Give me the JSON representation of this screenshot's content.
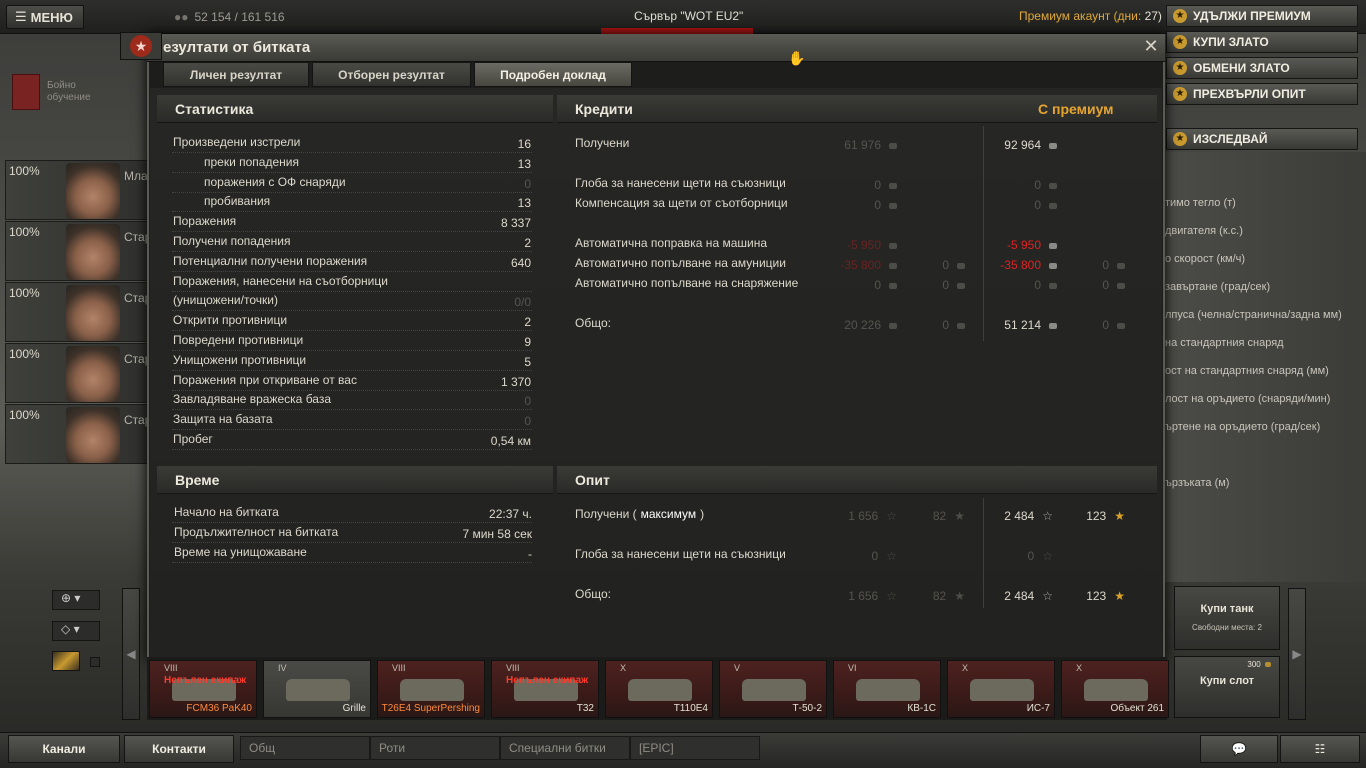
{
  "topbar": {
    "menu_label": "МЕНЮ",
    "player_stats": "52 154 / 161 516",
    "server": "Сървър \"WOT EU2\"",
    "premium_label": "Премиум акаунт (дни:",
    "premium_days": "27)"
  },
  "right_buttons": [
    {
      "label": "УДЪЛЖИ ПРЕМИУМ"
    },
    {
      "label": "КУПИ ЗЛАТО"
    },
    {
      "label": "ОБМЕНИ ЗЛАТО"
    },
    {
      "label": "ПРЕХВЪРЛИ ОПИТ"
    },
    {
      "label": "ИЗСЛЕДВАЙ"
    }
  ],
  "tech_params": [
    "тимо тегло (т)",
    "двигателя (к.с.)",
    "о скорост (км/ч)",
    "завъртане (град/сек)",
    "лпуса (челна/странична/задна мм)",
    "на стандартния снаряд",
    "ост на стандартния снаряд (мм)",
    "лост на оръдието (снаряди/мин)",
    "ъртене на оръдието (град/сек)",
    "ързъката (м)"
  ],
  "training": {
    "label_1": "Бойно",
    "label_2": "обучение"
  },
  "crew": [
    {
      "pct": "100%",
      "rank": "Мла"
    },
    {
      "pct": "100%",
      "rank": "Стар"
    },
    {
      "pct": "100%",
      "rank": "Стар"
    },
    {
      "pct": "100%",
      "rank": "Стар"
    },
    {
      "pct": "100%",
      "rank": "Стар"
    }
  ],
  "dialog": {
    "title": "езултати от битката",
    "tabs": [
      "Личен резултат",
      "Отборен резултат",
      "Подробен доклад"
    ]
  },
  "stats": {
    "title": "Статистика",
    "rows": [
      {
        "label": "Произведени изстрели",
        "value": "16",
        "indent": false,
        "dim": false
      },
      {
        "label": "преки попадения",
        "value": "13",
        "indent": true,
        "dim": false
      },
      {
        "label": "поражения с ОФ снаряди",
        "value": "0",
        "indent": true,
        "dim": true
      },
      {
        "label": "пробивания",
        "value": "13",
        "indent": true,
        "dim": false
      },
      {
        "label": "Поражения",
        "value": "8 337",
        "indent": false,
        "dim": false
      },
      {
        "label": "Получени попадения",
        "value": "2",
        "indent": false,
        "dim": false
      },
      {
        "label": "Потенциални получени поражения",
        "value": "640",
        "indent": false,
        "dim": false
      },
      {
        "label": "Поражения, нанесени на съотборници",
        "value": "",
        "indent": false,
        "dim": false
      },
      {
        "label": "(унищожени/точки)",
        "value": "0/0",
        "indent": false,
        "dim": true
      },
      {
        "label": "Открити противници",
        "value": "2",
        "indent": false,
        "dim": false
      },
      {
        "label": "Повредени противници",
        "value": "9",
        "indent": false,
        "dim": false
      },
      {
        "label": "Унищожени противници",
        "value": "5",
        "indent": false,
        "dim": false
      },
      {
        "label": "Поражения при откриване от вас",
        "value": "1 370",
        "indent": false,
        "dim": false
      },
      {
        "label": "Завладяване вражеска база",
        "value": "0",
        "indent": false,
        "dim": true
      },
      {
        "label": "Защита на базата",
        "value": "0",
        "indent": false,
        "dim": true
      },
      {
        "label": "Пробег",
        "value": "0,54 км",
        "indent": false,
        "dim": false
      }
    ]
  },
  "time": {
    "title": "Време",
    "rows": [
      {
        "label": "Начало на битката",
        "value": "22:37 ч."
      },
      {
        "label": "Продължителност на битката",
        "value": "7 мин 58 сек"
      },
      {
        "label": "Време на унищожаване",
        "value": "-"
      }
    ]
  },
  "credits": {
    "title": "Кредити",
    "premium_title": "С премиум",
    "rows": [
      {
        "label": "Получени",
        "base": "61 976",
        "base_gold": "",
        "prem": "92 964",
        "prem_gold": "",
        "kind": "normal"
      },
      {
        "label": "Глоба за нанесени щети на съюзници",
        "base": "0",
        "base_gold": "",
        "prem": "0",
        "prem_gold": "",
        "kind": "dim"
      },
      {
        "label": "Компенсация за щети от съотборници",
        "base": "0",
        "base_gold": "",
        "prem": "0",
        "prem_gold": "",
        "kind": "dim"
      },
      {
        "label": "Автоматична поправка на машина",
        "base": "-5 950",
        "base_gold": "",
        "prem": "-5 950",
        "prem_gold": "",
        "kind": "red"
      },
      {
        "label": "Автоматично попълване на амуниции",
        "base": "-35 800",
        "base_gold": "0",
        "prem": "-35 800",
        "prem_gold": "0",
        "kind": "red"
      },
      {
        "label": "Автоматично попълване на снаряжение",
        "base": "0",
        "base_gold": "0",
        "prem": "0",
        "prem_gold": "0",
        "kind": "dim"
      },
      {
        "label": "Общо:",
        "base": "20 226",
        "base_gold": "0",
        "prem": "51 214",
        "prem_gold": "0",
        "kind": "total"
      }
    ]
  },
  "experience": {
    "title": "Опит",
    "received_label": "Получени (",
    "received_max": "максимум",
    "received_close": ")",
    "rows": [
      {
        "base": "1 656",
        "base_free": "82",
        "prem": "2 484",
        "prem_free": "123"
      },
      {
        "label": "Глоба за нанесени щети на съюзници",
        "base": "0",
        "prem": "0"
      },
      {
        "label": "Общо:",
        "base": "1 656",
        "base_free": "82",
        "prem": "2 484",
        "prem_free": "123"
      }
    ]
  },
  "tanks": [
    {
      "name": "FCM36 PaK40",
      "tier": "VIII",
      "crew_warning": "Непълен екипаж",
      "style": "red",
      "name_color": "orange"
    },
    {
      "name": "Grille",
      "tier": "IV",
      "crew_warning": "",
      "style": "grey",
      "name_color": "white"
    },
    {
      "name": "T26E4 SuperPershing",
      "tier": "VIII",
      "crew_warning": "",
      "style": "red",
      "name_color": "orange"
    },
    {
      "name": "T32",
      "tier": "VIII",
      "crew_warning": "Непълен екипаж",
      "style": "red",
      "name_color": "white"
    },
    {
      "name": "T110E4",
      "tier": "X",
      "crew_warning": "",
      "style": "red",
      "name_color": "white"
    },
    {
      "name": "Т-50-2",
      "tier": "V",
      "crew_warning": "",
      "style": "red",
      "name_color": "white"
    },
    {
      "name": "КВ-1С",
      "tier": "VI",
      "crew_warning": "",
      "style": "red",
      "name_color": "white"
    },
    {
      "name": "ИС-7",
      "tier": "X",
      "crew_warning": "",
      "style": "red",
      "name_color": "white"
    },
    {
      "name": "Объект 261",
      "tier": "X",
      "crew_warning": "",
      "style": "red",
      "name_color": "white"
    }
  ],
  "shop": {
    "buy_tank": "Купи танк",
    "free_slots": "Свободни места: 2",
    "buy_slot": "Купи слот",
    "slot_price": "300"
  },
  "bottombar": {
    "channels": "Канали",
    "contacts": "Контакти",
    "chat_tabs": [
      "Общ",
      "Роти",
      "Специални битки",
      "[EPIC]"
    ]
  }
}
